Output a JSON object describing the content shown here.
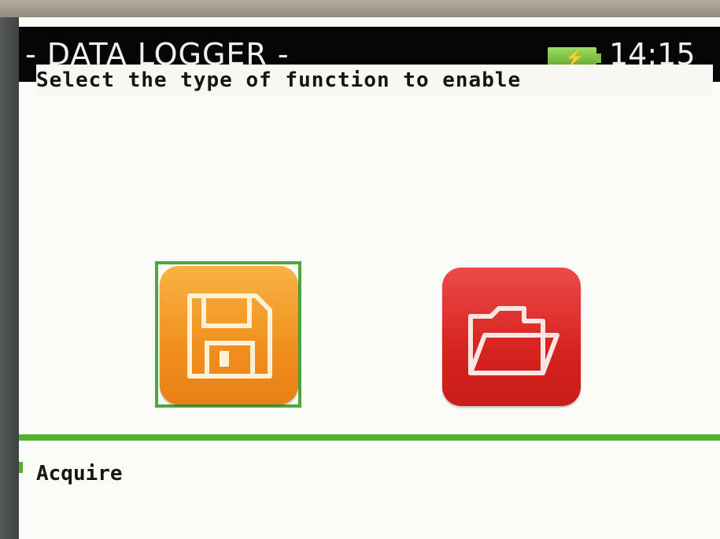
{
  "app": {
    "title": "- DATA LOGGER -",
    "clock": "14:15"
  },
  "status_icons": {
    "battery": "battery-charging-icon",
    "battery_color": "#7ec046"
  },
  "screen": {
    "instruction": "Select the type of function to enable"
  },
  "functions": [
    {
      "icon": "floppy-disk-icon",
      "color": "#f08f1d",
      "selected": true
    },
    {
      "icon": "folder-open-icon",
      "color": "#d6231f",
      "selected": false
    }
  ],
  "status_bar": {
    "selected_function_label": "Acquire",
    "accent_color": "#54b02f"
  }
}
